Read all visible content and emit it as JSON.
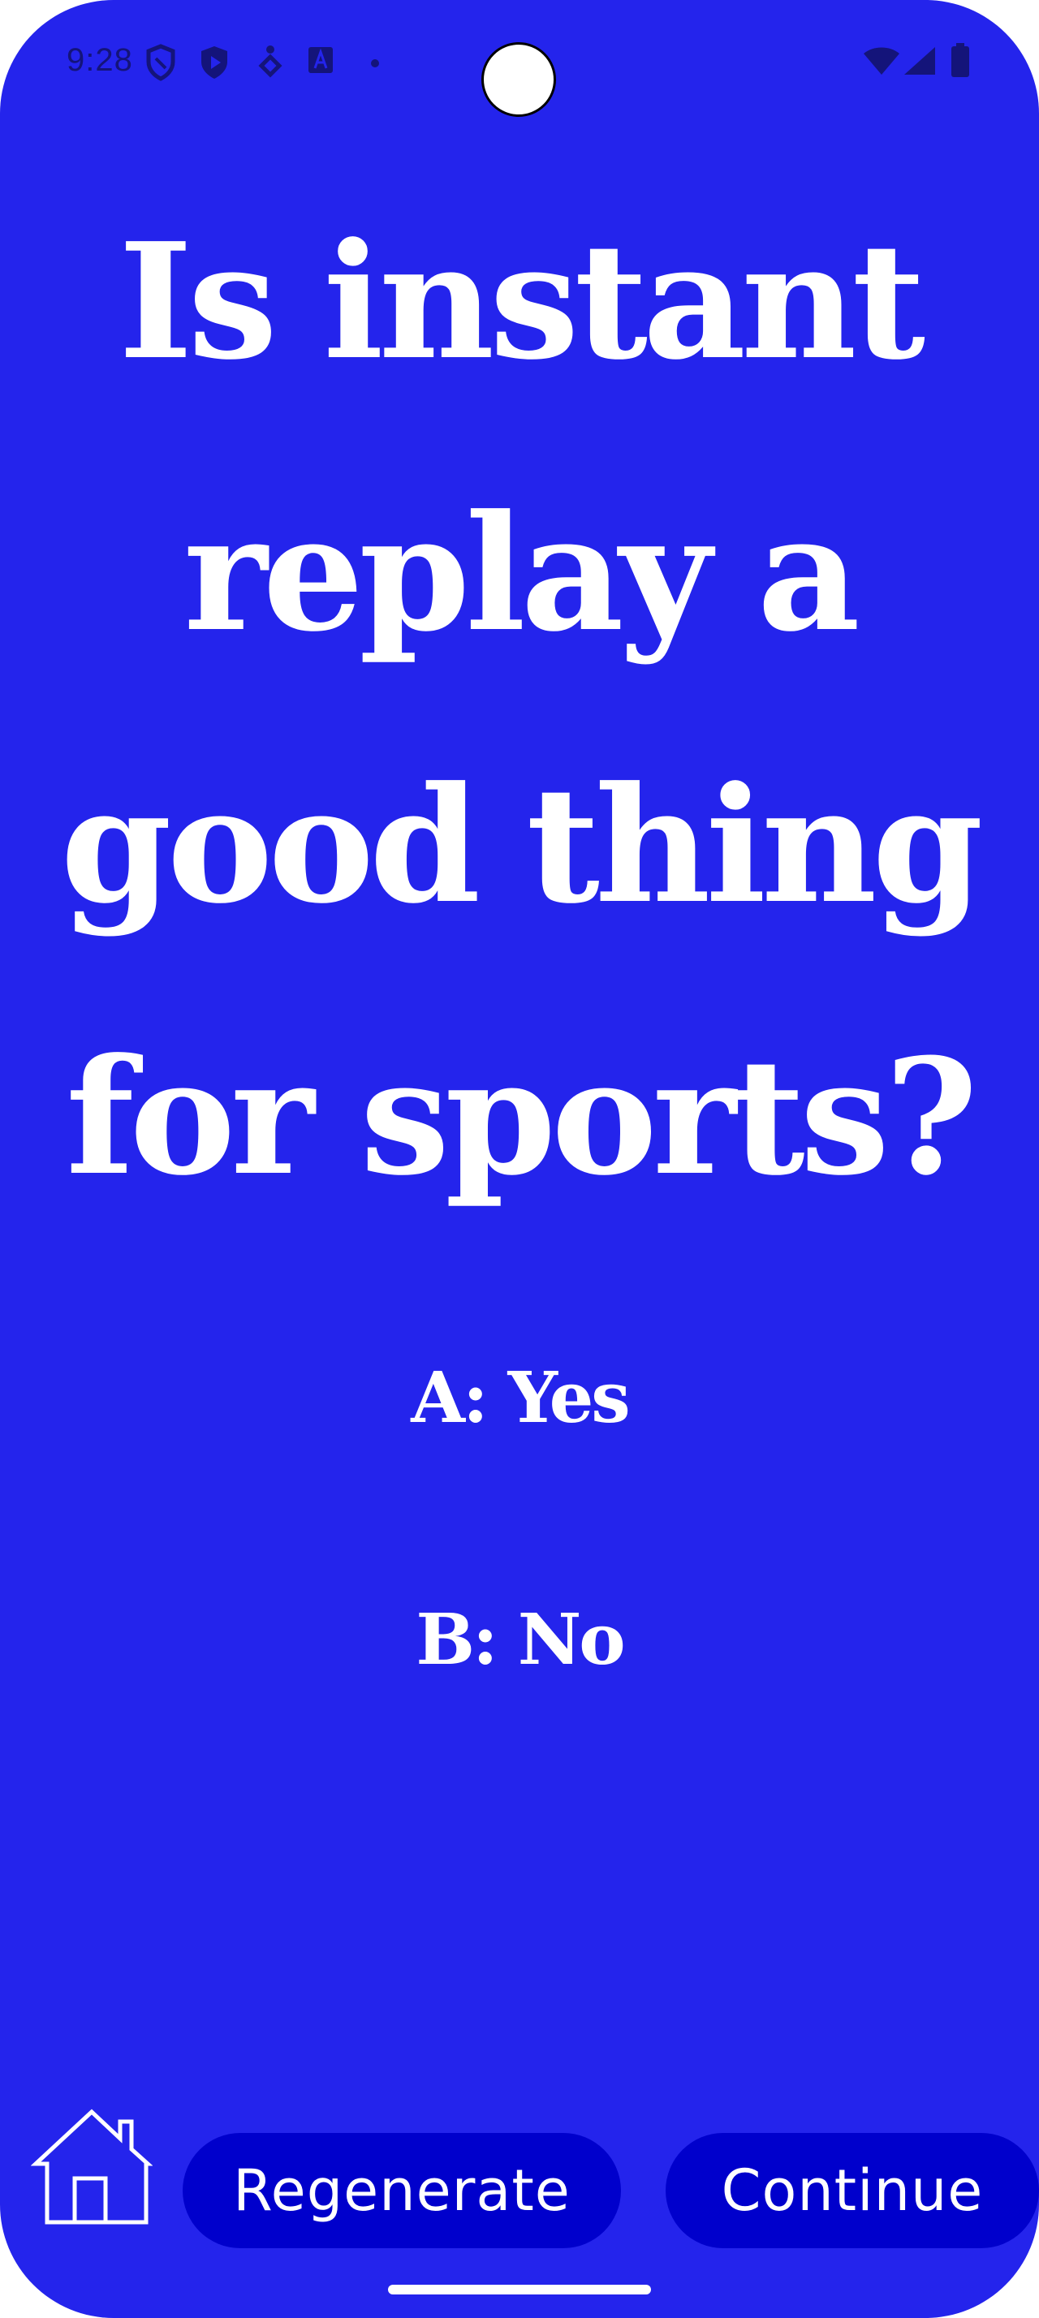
{
  "status_bar": {
    "time": "9:28",
    "left_icons": [
      "shield-icon",
      "play-protect-icon",
      "accessibility-icon",
      "font-a-icon",
      "dot-icon"
    ],
    "right_icons": [
      "wifi-icon",
      "signal-icon",
      "battery-icon"
    ]
  },
  "question": {
    "text": "Is instant replay a good thing for sports?"
  },
  "options": {
    "a": "A: Yes",
    "b": "B: No"
  },
  "bottom_bar": {
    "home_icon": "home-icon",
    "regenerate_label": "Regenerate",
    "continue_label": "Continue"
  },
  "colors": {
    "background": "#2424EC",
    "button": "#0000CC",
    "text": "#FFFFFF"
  }
}
